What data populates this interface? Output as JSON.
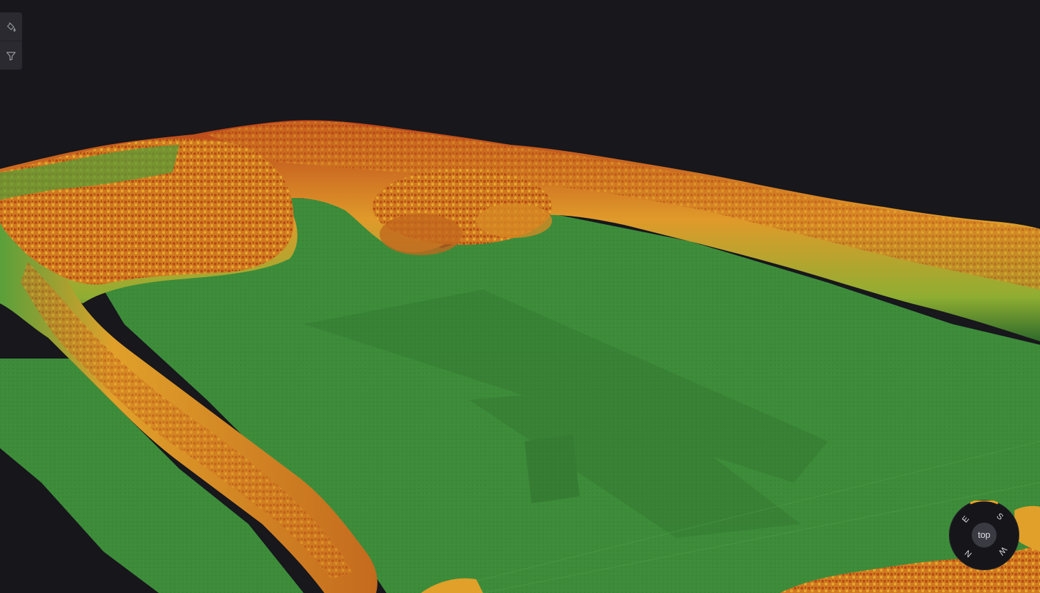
{
  "toolbar": {
    "items": [
      {
        "icon": "paint-bucket-icon"
      },
      {
        "icon": "filter-icon"
      }
    ]
  },
  "compass": {
    "center_label": "top",
    "directions": [
      "S",
      "W",
      "N",
      "E"
    ]
  },
  "colors": {
    "background": "#17171c",
    "ground": "#3f8f3c",
    "low_vegetation": "#6aa83a",
    "mid_canopy": "#e0a02a",
    "high_canopy": "#c0461a",
    "compass_accent": "#f0a020"
  }
}
